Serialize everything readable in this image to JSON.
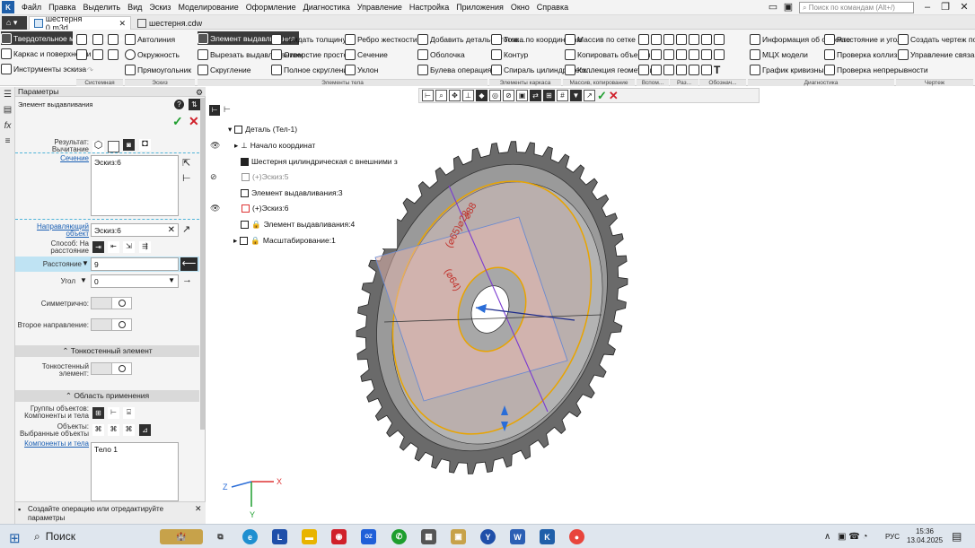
{
  "menu": {
    "items": [
      "Файл",
      "Правка",
      "Выделить",
      "Вид",
      "Эскиз",
      "Моделирование",
      "Оформление",
      "Диагностика",
      "Управление",
      "Настройка",
      "Приложения",
      "Окно",
      "Справка"
    ],
    "search_placeholder": "Поиск по командам (Alt+/)"
  },
  "tabs": {
    "tab1": "шестерня 0.m3d",
    "tab2": "шестерня.cdw"
  },
  "ribbon": {
    "left1": "Твердотельное моделирование",
    "left2": "Каркас и поверхности",
    "left3": "Инструменты эскиза",
    "b_autoline": "Автолиния",
    "b_circle": "Окружность",
    "b_rect": "Прямоугольник",
    "b_extrude": "Элемент выдавливания",
    "b_cut": "Вырезать выдавливанием",
    "b_fillet": "Скругление",
    "b_thick": "Придать толщину",
    "b_hole": "Отверстие простое",
    "b_filletfull": "Полное скругление",
    "b_rib": "Ребро жесткости",
    "b_section": "Сечение",
    "b_slope": "Уклон",
    "b_addpart": "Добавить деталь-заготов...",
    "b_shell": "Оболочка",
    "b_bool": "Булева операция",
    "b_point": "Точка по координатам",
    "b_contour": "Контур",
    "b_spiral": "Спираль цилиндрическ...",
    "b_array": "Массив по сетке",
    "b_copy": "Копировать объекты",
    "b_collection": "Коллекция геометрии",
    "b_info": "Информация об объекте",
    "b_mcs": "МЦХ модели",
    "b_curv": "График кривизны",
    "b_dist": "Расстояние и угол",
    "b_collis": "Проверка коллизий",
    "b_contin": "Проверка непрерывности",
    "b_drawing": "Создать чертеж по модели",
    "b_linked": "Управление связанными ч...",
    "groups": [
      "Системная",
      "Эскиз",
      "Элементы тела",
      "Элементы каркаса",
      "Массив, копирование",
      "Вспом...",
      "Раз...",
      "Обознач...",
      "Диагностика",
      "Чертеж"
    ]
  },
  "panel": {
    "header": "Параметры",
    "title": "Элемент выдавливания",
    "result_label": "Результат: Вычитание",
    "section_label": "Сечение",
    "section_value": "Эскиз:6",
    "direction_label": "Направляющий объект",
    "direction_value": "Эскиз:6",
    "method_label": "Способ: На расстояние",
    "distance_label": "Расстояние",
    "distance_value": "9",
    "angle_label": "Угол",
    "angle_value": "0",
    "symmetric_label": "Симметрично:",
    "second_dir_label": "Второе направление:",
    "thin_section": "Тонкостенный элемент",
    "thin_label": "Тонкостенный элемент:",
    "scope_section": "Область применения",
    "groups_label": "Группы объектов: Компоненты и тела",
    "objects_label": "Объекты: Выбранные объекты",
    "components_label": "Компоненты и тела",
    "components_value": "Тело 1",
    "hint": "Создайте операцию или отредактируйте параметры"
  },
  "tree": {
    "root": "Деталь (Тел-1)",
    "origin": "Начало координат",
    "gear": "Шестерня цилиндрическая с внешними з",
    "sketch5": "(+)Эскиз:5",
    "extrude3": "Элемент выдавливания:3",
    "sketch6": "(+)Эскиз:6",
    "extrude4": "Элемент выдавливания:4",
    "scale1": "Масштабирование:1"
  },
  "viewport": {
    "dim1": "⌀88",
    "dim2": "(⌀65)⌀28",
    "dim3": "(⌀64)",
    "axis_x": "X",
    "axis_y": "Y",
    "axis_z": "Z"
  },
  "taskbar": {
    "search": "Поиск",
    "lang": "РУС",
    "time": "15:36",
    "date": "13.04.2025"
  },
  "colors": {
    "accent": "#1a5fb4",
    "ok": "#1e9e2e",
    "cancel": "#d0202a",
    "sketch": "#e8a400"
  }
}
